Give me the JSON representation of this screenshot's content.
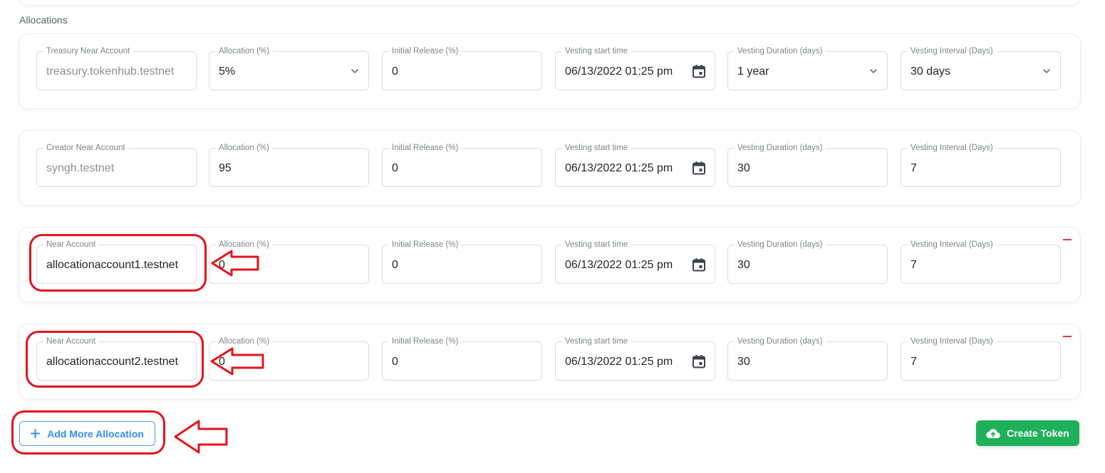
{
  "section": {
    "title": "Allocations"
  },
  "rows": [
    {
      "fields": [
        {
          "label": "Treasury Near Account",
          "value": "treasury.tokenhub.testnet",
          "muted": true
        },
        {
          "label": "Allocation (%)",
          "value": "5%",
          "type": "select"
        },
        {
          "label": "Initial Release (%)",
          "value": "0"
        },
        {
          "label": "Vesting start time",
          "value": "06/13/2022 01:25 pm",
          "type": "date"
        },
        {
          "label": "Vesting Duration (days)",
          "value": "1 year",
          "type": "select"
        },
        {
          "label": "Vesting Interval (Days)",
          "value": "30 days",
          "type": "select"
        }
      ],
      "removable": false
    },
    {
      "fields": [
        {
          "label": "Creator Near Account",
          "value": "syngh.testnet",
          "muted": true
        },
        {
          "label": "Allocation (%)",
          "value": "95"
        },
        {
          "label": "Initial Release (%)",
          "value": "0"
        },
        {
          "label": "Vesting start time",
          "value": "06/13/2022 01:25 pm",
          "type": "date"
        },
        {
          "label": "Vesting Duration (days)",
          "value": "30"
        },
        {
          "label": "Vesting Interval (Days)",
          "value": "7"
        }
      ],
      "removable": false
    },
    {
      "fields": [
        {
          "label": "Near Account",
          "value": "allocationaccount1.testnet"
        },
        {
          "label": "Allocation (%)",
          "value": "0"
        },
        {
          "label": "Initial Release (%)",
          "value": "0"
        },
        {
          "label": "Vesting start time",
          "value": "06/13/2022 01:25 pm",
          "type": "date"
        },
        {
          "label": "Vesting Duration (days)",
          "value": "30"
        },
        {
          "label": "Vesting Interval (Days)",
          "value": "7"
        }
      ],
      "removable": true
    },
    {
      "fields": [
        {
          "label": "Near Account",
          "value": "allocationaccount2.testnet"
        },
        {
          "label": "Allocation (%)",
          "value": "0"
        },
        {
          "label": "Initial Release (%)",
          "value": "0"
        },
        {
          "label": "Vesting start time",
          "value": "06/13/2022 01:25 pm",
          "type": "date"
        },
        {
          "label": "Vesting Duration (days)",
          "value": "30"
        },
        {
          "label": "Vesting Interval (Days)",
          "value": "7"
        }
      ],
      "removable": true
    }
  ],
  "actions": {
    "add_label": "Add More Allocation",
    "add_icon": "plus-icon",
    "create_label": "Create Token",
    "create_icon": "cloud-upload-icon"
  },
  "colors": {
    "accent": "#2f8ef2",
    "success": "#1fb05a",
    "danger": "#e53935",
    "annotation": "#e3131b"
  }
}
